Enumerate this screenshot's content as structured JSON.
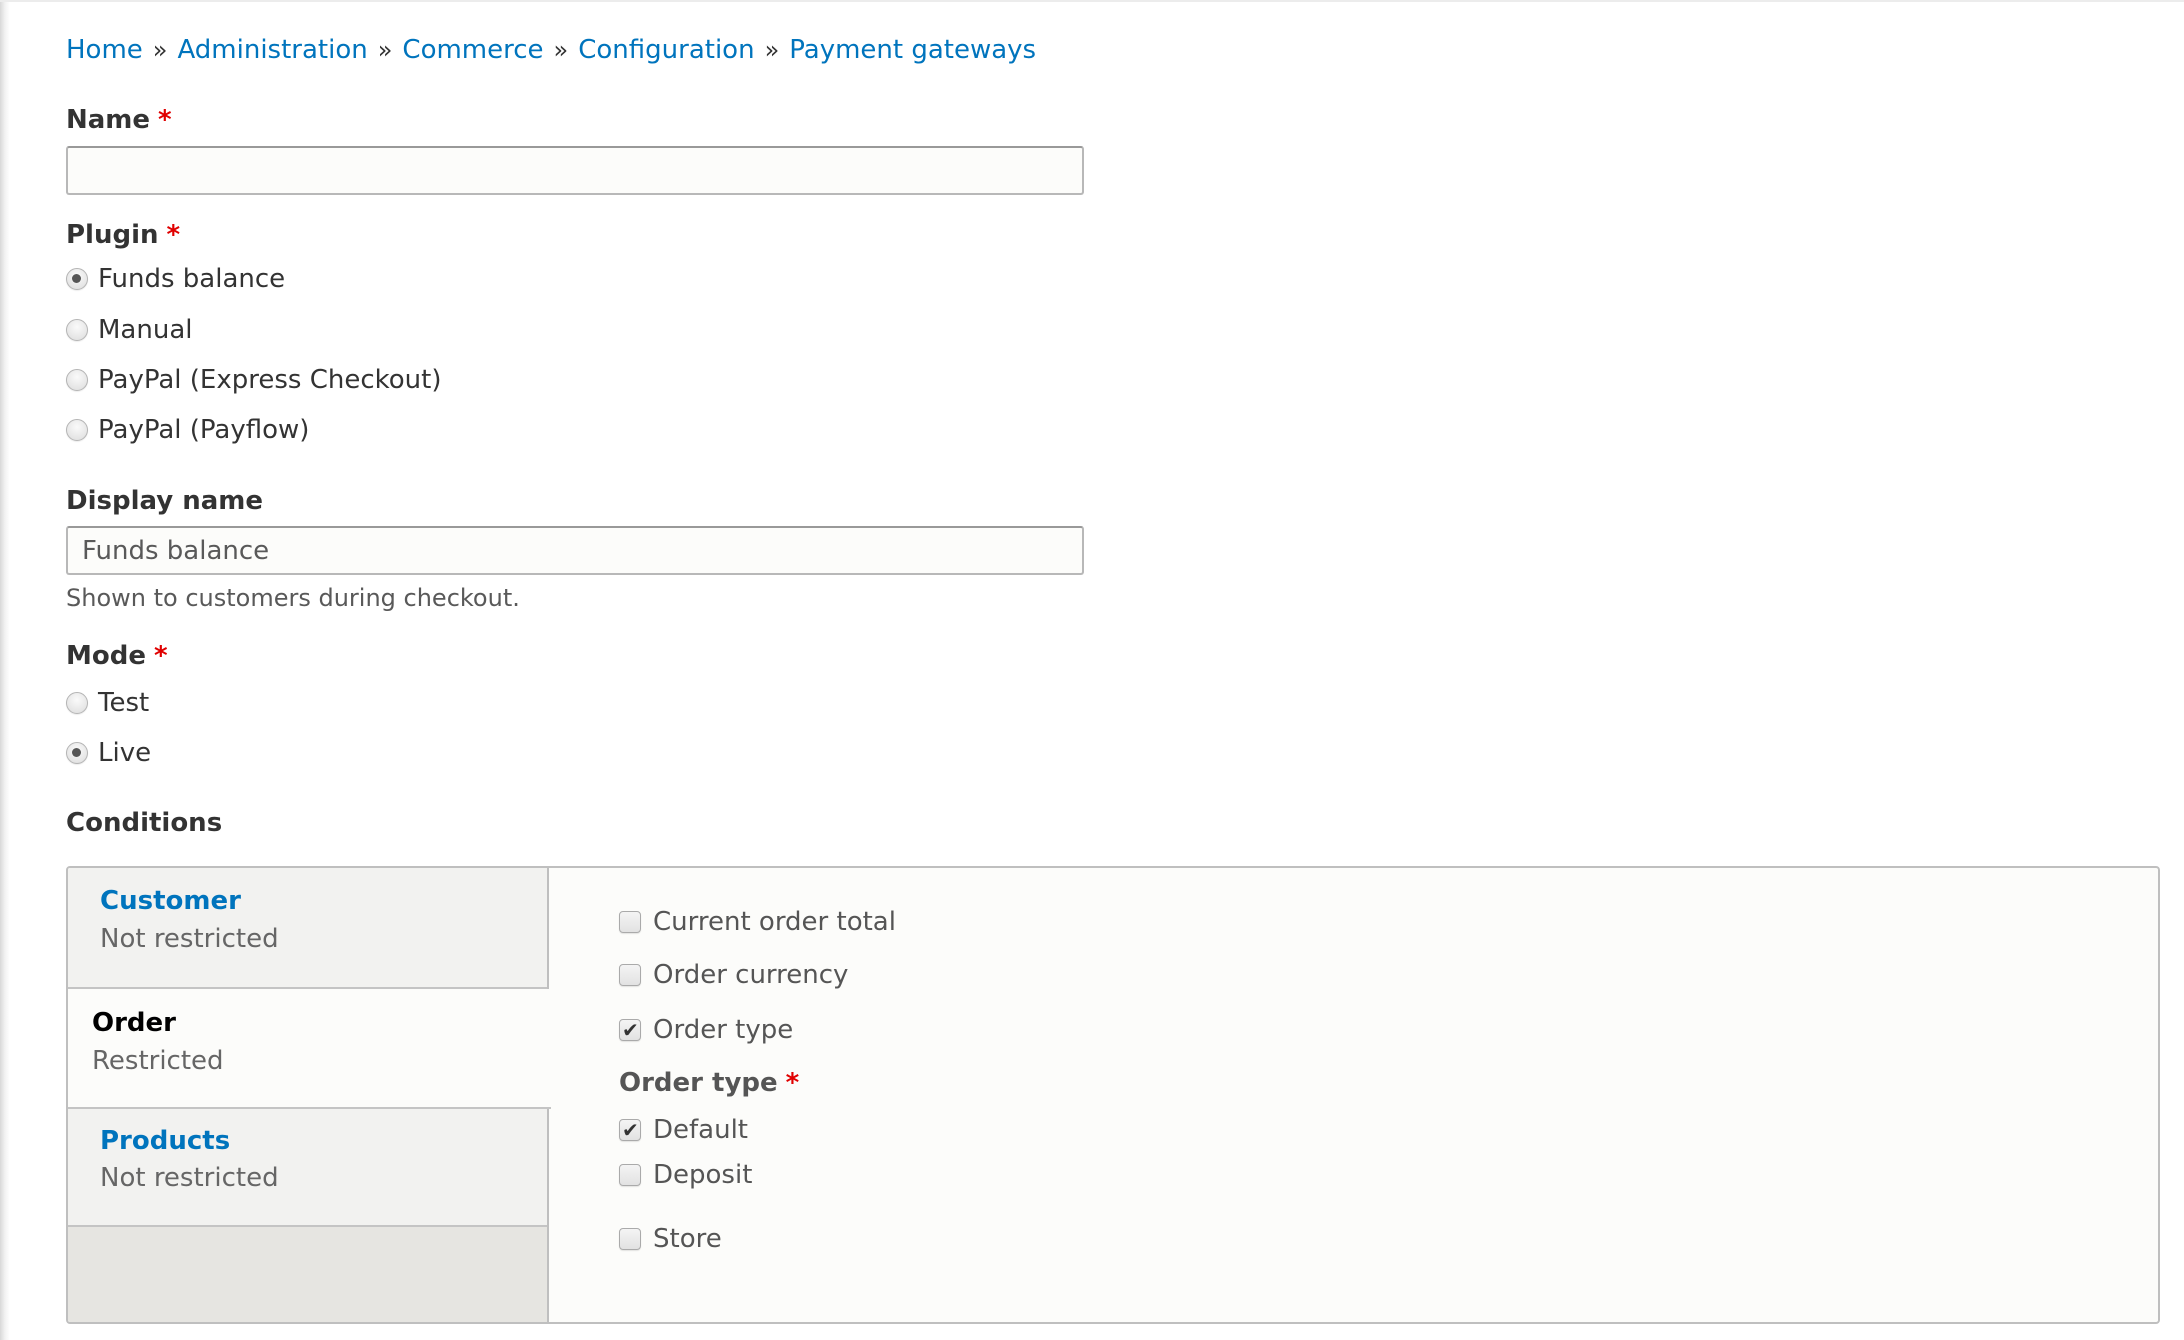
{
  "breadcrumb": {
    "items": [
      "Home",
      "Administration",
      "Commerce",
      "Configuration",
      "Payment gateways"
    ],
    "separator": "»"
  },
  "name_field": {
    "label": "Name",
    "required_marker": "*",
    "value": "",
    "placeholder": ""
  },
  "plugin_field": {
    "label": "Plugin",
    "required_marker": "*",
    "options": [
      {
        "label": "Funds balance",
        "checked": true
      },
      {
        "label": "Manual",
        "checked": false
      },
      {
        "label": "PayPal (Express Checkout)",
        "checked": false
      },
      {
        "label": "PayPal (Payflow)",
        "checked": false
      }
    ]
  },
  "display_name_field": {
    "label": "Display name",
    "value": "Funds balance",
    "description": "Shown to customers during checkout."
  },
  "mode_field": {
    "label": "Mode",
    "required_marker": "*",
    "options": [
      {
        "label": "Test",
        "checked": false
      },
      {
        "label": "Live",
        "checked": true
      }
    ]
  },
  "conditions": {
    "label": "Conditions",
    "tabs": [
      {
        "title": "Customer",
        "summary": "Not restricted",
        "selected": false
      },
      {
        "title": "Order",
        "summary": "Restricted",
        "selected": true
      },
      {
        "title": "Products",
        "summary": "Not restricted",
        "selected": false
      }
    ],
    "order_pane": {
      "conditions": [
        {
          "label": "Current order total",
          "checked": false
        },
        {
          "label": "Order currency",
          "checked": false
        },
        {
          "label": "Order type",
          "checked": true
        }
      ],
      "order_type": {
        "label": "Order type",
        "required_marker": "*",
        "options": [
          {
            "label": "Default",
            "checked": true
          },
          {
            "label": "Deposit",
            "checked": false
          }
        ]
      },
      "store": {
        "label": "Store",
        "checked": false
      }
    }
  },
  "colors": {
    "link": "#0074bd",
    "required": "#e00000",
    "text": "#333333",
    "muted_text": "#595959"
  }
}
